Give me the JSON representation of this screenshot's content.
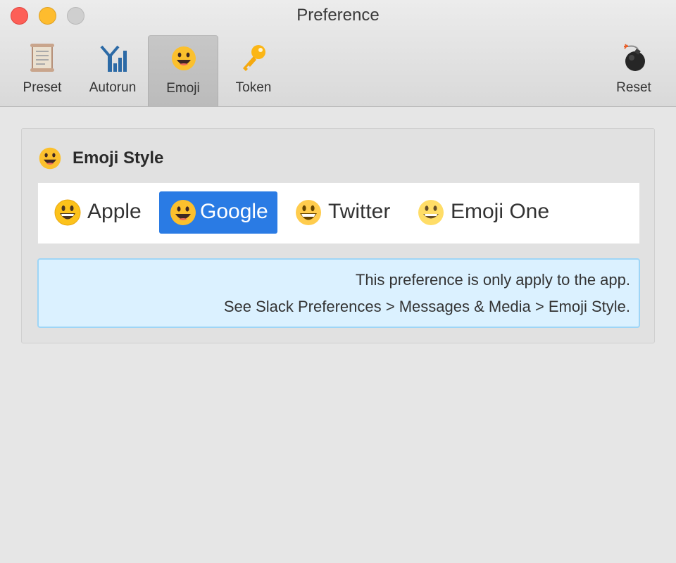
{
  "window": {
    "title": "Preference",
    "controls": [
      "close",
      "minimize",
      "maximize"
    ]
  },
  "toolbar": {
    "items": [
      {
        "label": "Preset",
        "icon": "scroll-icon",
        "selected": false
      },
      {
        "label": "Autorun",
        "icon": "signal-icon",
        "selected": false
      },
      {
        "label": "Emoji",
        "icon": "smile-emoji-icon",
        "selected": true
      },
      {
        "label": "Token",
        "icon": "key-icon",
        "selected": false
      },
      {
        "label": "Reset",
        "icon": "bomb-icon",
        "selected": false
      }
    ]
  },
  "emoji_style": {
    "heading": "Emoji Style",
    "heading_icon": "smile-emoji-icon",
    "options": [
      {
        "label": "Apple",
        "icon": "apple-smile-icon",
        "selected": false
      },
      {
        "label": "Google",
        "icon": "google-smile-icon",
        "selected": true
      },
      {
        "label": "Twitter",
        "icon": "twitter-smile-icon",
        "selected": false
      },
      {
        "label": "Emoji One",
        "icon": "emojione-smile-icon",
        "selected": false
      }
    ],
    "selected": "Google"
  },
  "info": {
    "line1": "This preference is only apply to the app.",
    "line2": "See Slack Preferences > Messages & Media > Emoji Style."
  },
  "colors": {
    "selected_option": "#2a7be4",
    "info_background": "#dbf1ff",
    "info_border": "#9ed5f6",
    "close": "#fd5f57",
    "minimize": "#febc2e"
  }
}
